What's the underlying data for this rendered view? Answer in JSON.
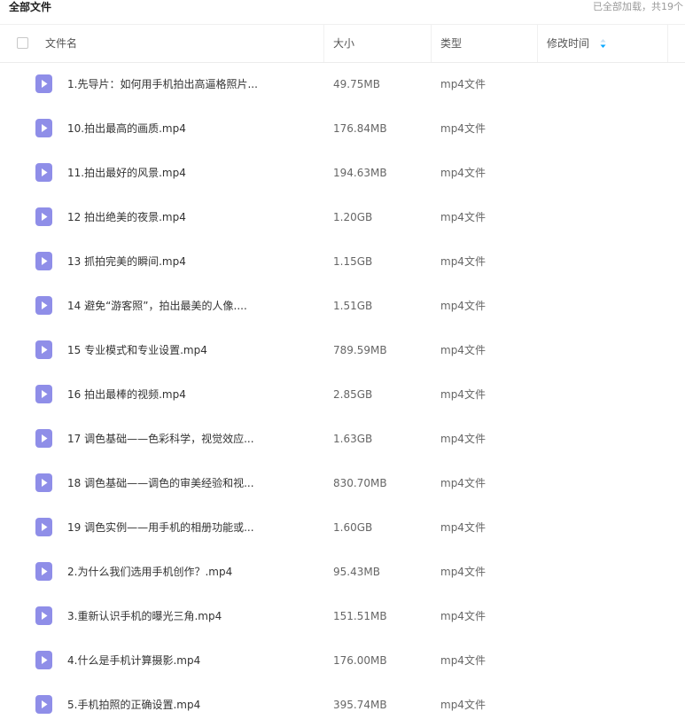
{
  "header": {
    "title": "全部文件",
    "status": "已全部加载，共19个"
  },
  "columns": {
    "name": "文件名",
    "size": "大小",
    "type": "类型",
    "modified": "修改时间"
  },
  "icons": {
    "file": "video-file-icon",
    "sort": "sort-arrow-icon"
  },
  "colors": {
    "file_icon": "#8f8ee8",
    "sort_accent": "#06a7ff"
  },
  "files": [
    {
      "name": "1.先导片：如何用手机拍出高逼格照片...",
      "size": "49.75MB",
      "type": "mp4文件"
    },
    {
      "name": "10.拍出最高的画质.mp4",
      "size": "176.84MB",
      "type": "mp4文件"
    },
    {
      "name": "11.拍出最好的风景.mp4",
      "size": "194.63MB",
      "type": "mp4文件"
    },
    {
      "name": "12 拍出绝美的夜景.mp4",
      "size": "1.20GB",
      "type": "mp4文件"
    },
    {
      "name": "13 抓拍完美的瞬间.mp4",
      "size": "1.15GB",
      "type": "mp4文件"
    },
    {
      "name": "14 避免“游客照”，拍出最美的人像....",
      "size": "1.51GB",
      "type": "mp4文件"
    },
    {
      "name": "15 专业模式和专业设置.mp4",
      "size": "789.59MB",
      "type": "mp4文件"
    },
    {
      "name": "16 拍出最棒的视频.mp4",
      "size": "2.85GB",
      "type": "mp4文件"
    },
    {
      "name": "17 调色基础——色彩科学，视觉效应...",
      "size": "1.63GB",
      "type": "mp4文件"
    },
    {
      "name": "18 调色基础——调色的审美经验和视...",
      "size": "830.70MB",
      "type": "mp4文件"
    },
    {
      "name": "19 调色实例——用手机的相册功能或...",
      "size": "1.60GB",
      "type": "mp4文件"
    },
    {
      "name": "2.为什么我们选用手机创作？.mp4",
      "size": "95.43MB",
      "type": "mp4文件"
    },
    {
      "name": "3.重新认识手机的曝光三角.mp4",
      "size": "151.51MB",
      "type": "mp4文件"
    },
    {
      "name": "4.什么是手机计算摄影.mp4",
      "size": "176.00MB",
      "type": "mp4文件"
    },
    {
      "name": "5.手机拍照的正确设置.mp4",
      "size": "395.74MB",
      "type": "mp4文件"
    }
  ]
}
